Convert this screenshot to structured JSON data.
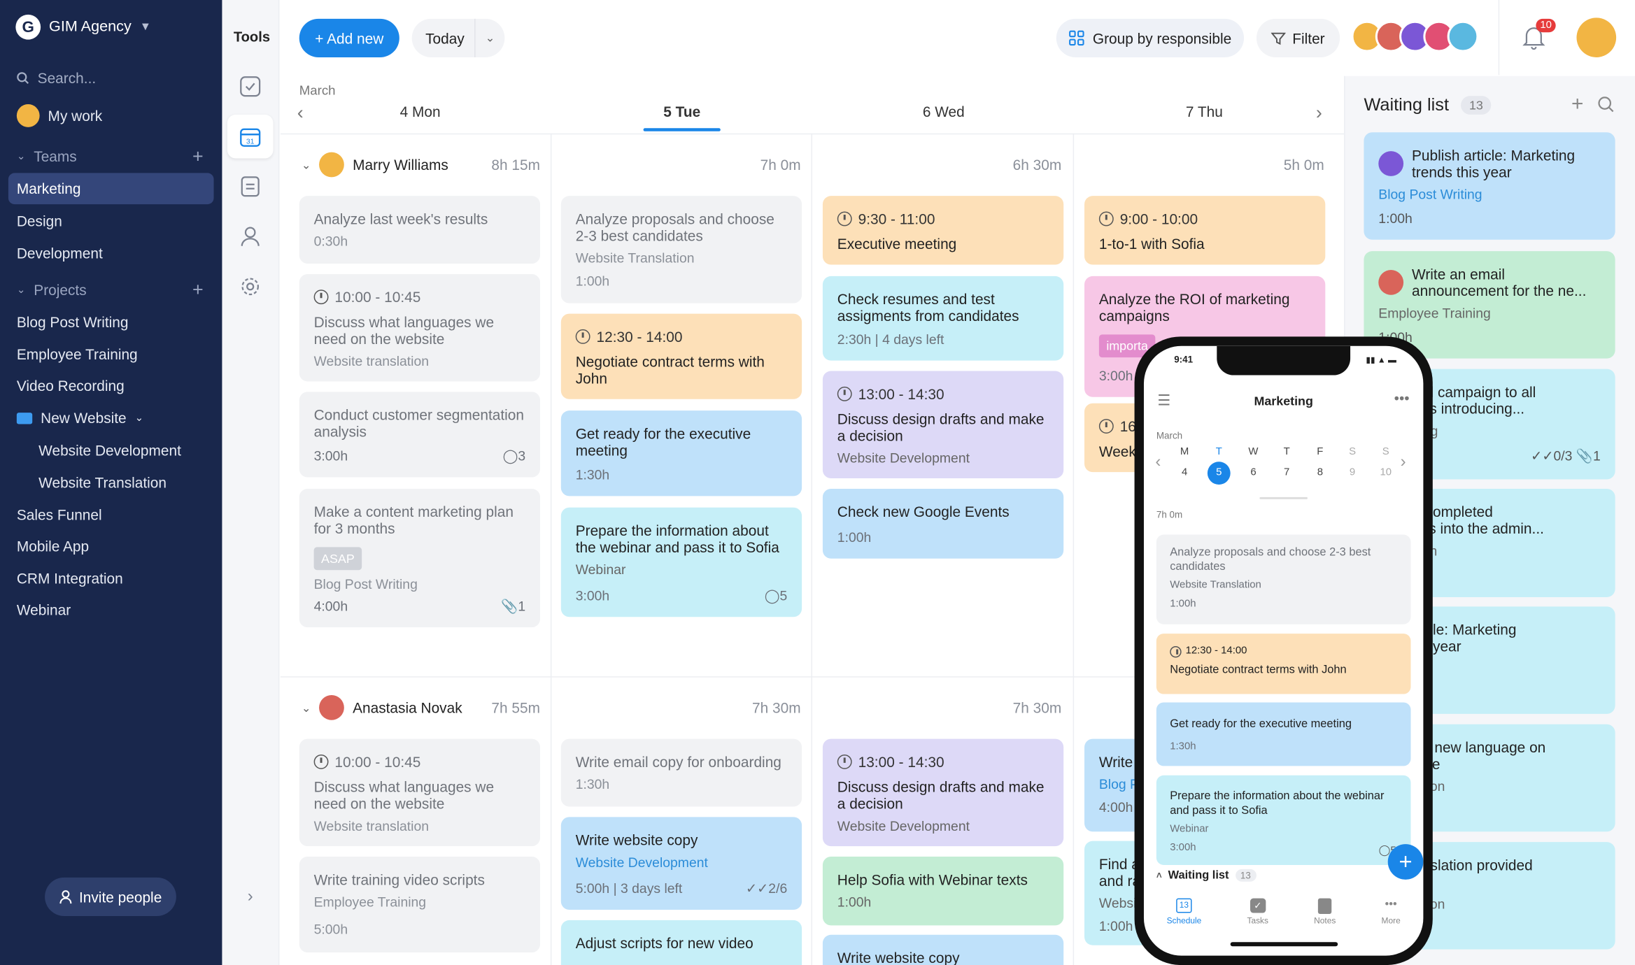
{
  "workspace": {
    "name": "GIM Agency"
  },
  "sidebar": {
    "search_placeholder": "Search...",
    "my_work": "My work",
    "teams_label": "Teams",
    "teams": [
      "Marketing",
      "Design",
      "Development"
    ],
    "projects_label": "Projects",
    "projects": [
      "Blog Post Writing",
      "Employee Training",
      "Video Recording"
    ],
    "folder": "New Website",
    "folder_items": [
      "Website Development",
      "Website Translation"
    ],
    "more_projects": [
      "Sales Funnel",
      "Mobile App",
      "CRM Integration",
      "Webinar"
    ],
    "invite": "Invite people"
  },
  "tools": {
    "title": "Tools"
  },
  "toolbar": {
    "add_new": "+ Add new",
    "today": "Today",
    "group_by": "Group by responsible",
    "filter": "Filter",
    "notifications": "10"
  },
  "calendar": {
    "month": "March",
    "days": [
      "4 Mon",
      "5 Tue",
      "6 Wed",
      "7 Thu"
    ],
    "people": [
      {
        "name": "Marry Williams",
        "durations": [
          "8h 15m",
          "7h 0m",
          "6h 30m",
          "5h 0m"
        ],
        "columns": [
          [
            {
              "title": "Analyze last week's results",
              "meta": "0:30h"
            },
            {
              "time": "10:00 - 10:45",
              "title": "Discuss what languages we need on the website",
              "sub": "Website translation"
            },
            {
              "title": "Conduct customer segmentation analysis",
              "meta": "3:00h",
              "count": "3"
            },
            {
              "title": "Make a content marketing plan for 3 months",
              "tag": "ASAP",
              "sub": "Blog Post Writing",
              "meta": "4:00h",
              "count": "1"
            }
          ],
          [
            {
              "title": "Analyze proposals and choose 2-3 best candidates",
              "sub": "Website Translation",
              "meta": "1:00h"
            },
            {
              "time": "12:30 - 14:00",
              "title": "Negotiate contract terms with John"
            },
            {
              "title": "Get ready for the executive meeting",
              "meta": "1:30h"
            },
            {
              "title": "Prepare the information about the webinar and pass it to Sofia",
              "sub": "Webinar",
              "meta": "3:00h",
              "count": "5"
            }
          ],
          [
            {
              "time": "9:30 - 11:00",
              "title": "Executive meeting"
            },
            {
              "title": "Check resumes and test assigments from candidates",
              "meta": "2:30h | 4 days left"
            },
            {
              "time": "13:00 - 14:30",
              "title": "Discuss design drafts and make a decision",
              "sub": "Website Development"
            },
            {
              "title": "Check new Google Events",
              "meta": "1:00h"
            }
          ],
          [
            {
              "time": "9:00 - 10:00",
              "title": "1-to-1 with Sofia"
            },
            {
              "title": "Analyze the ROI of marketing campaigns",
              "tag": "importa",
              "meta": "3:00h"
            },
            {
              "time": "16",
              "title": "Week"
            }
          ]
        ]
      },
      {
        "name": "Anastasia Novak",
        "durations": [
          "7h 55m",
          "7h 30m",
          "7h 30m"
        ],
        "columns": [
          [
            {
              "time": "10:00 - 10:45",
              "title": "Discuss what languages we need on the website",
              "sub": "Website translation"
            },
            {
              "title": "Write training video scripts",
              "sub": "Employee Training",
              "meta": "5:00h"
            }
          ],
          [
            {
              "title": "Write email copy for onboarding",
              "meta": "1:30h"
            },
            {
              "title": "Write website copy",
              "sub": "Website Development",
              "meta": "5:00h | 3 days left",
              "count": "2/6"
            },
            {
              "title": "Adjust scripts for new video"
            }
          ],
          [
            {
              "time": "13:00 - 14:30",
              "title": "Discuss design drafts and make a decision",
              "sub": "Website Development"
            },
            {
              "title": "Help Sofia with Webinar texts",
              "meta": "1:00h"
            },
            {
              "title": "Write website copy"
            }
          ],
          [
            {
              "title": "Write",
              "sub": "Blog P",
              "meta": "4:00h"
            },
            {
              "title": "Find a",
              "title2": "and ra",
              "sub": "Websi",
              "meta": "1:00h"
            }
          ]
        ]
      }
    ]
  },
  "waiting_list": {
    "title": "Waiting list",
    "count": "13",
    "items": [
      {
        "title": "Publish article: Marketing trends this year",
        "sub": "Blog Post Writing",
        "meta": "1:00h"
      },
      {
        "title": "Write an email announcement for the ne...",
        "sub": "Employee Training",
        "meta": "1:00h"
      },
      {
        "title": "nd email campaign to all",
        "title2": "nployees introducing...",
        "sub": "e Training",
        "meta": "0/3",
        "count": "1"
      },
      {
        "title": "oad all completed",
        "title2": "nslations into the admin...",
        "sub": "ranslation"
      },
      {
        "title": "eck article: Marketing",
        "title2": "nds this year",
        "sub": "t Writing"
      },
      {
        "title": "plement new language on",
        "title2": "e website",
        "sub": "Translation"
      },
      {
        "title": "eck translation provided",
        "title2": "agency",
        "sub": "Translation"
      }
    ]
  },
  "phone": {
    "time": "9:41",
    "title": "Marketing",
    "month": "March",
    "weekdays": [
      "M",
      "T",
      "W",
      "T",
      "F",
      "S",
      "S"
    ],
    "dates": [
      "4",
      "5",
      "6",
      "7",
      "8",
      "9",
      "10"
    ],
    "total": "7h 0m",
    "cards": [
      {
        "title": "Analyze proposals and choose 2-3 best candidates",
        "sub": "Website Translation",
        "meta": "1:00h"
      },
      {
        "time": "12:30 - 14:00",
        "title": "Negotiate contract terms with John"
      },
      {
        "title": "Get ready for the executive meeting",
        "meta": "1:30h"
      },
      {
        "title": "Prepare the information about the webinar and pass it to Sofia",
        "sub": "Webinar",
        "meta": "3:00h",
        "count": "5"
      }
    ],
    "waiting": "Waiting list",
    "waiting_count": "13",
    "tabs": [
      "Schedule",
      "Tasks",
      "Notes",
      "More"
    ],
    "calendar_icon_day": "13"
  }
}
